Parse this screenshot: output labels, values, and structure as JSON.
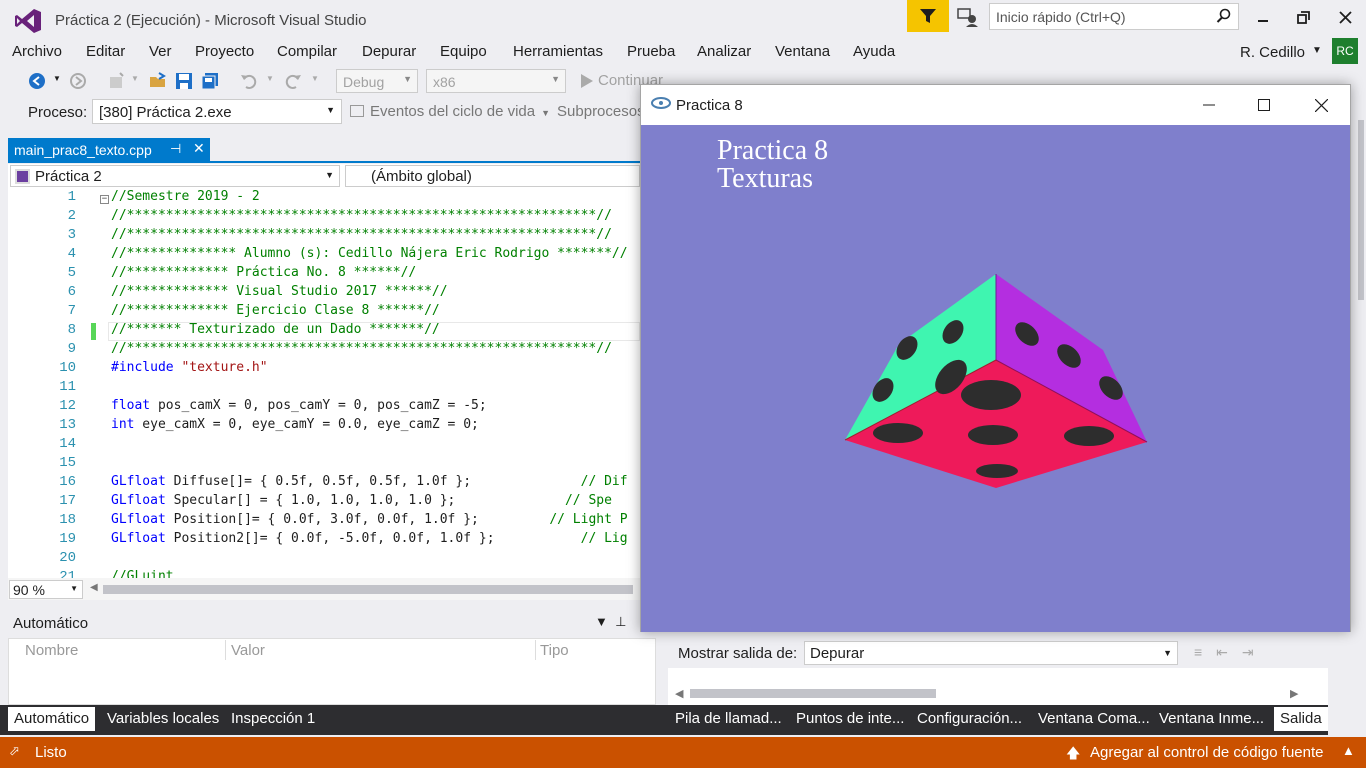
{
  "app": {
    "title": "Práctica 2 (Ejecución) - Microsoft Visual Studio",
    "quick_launch_placeholder": "Inicio rápido (Ctrl+Q)",
    "user": "R. Cedillo",
    "avatar_initials": "RC"
  },
  "menu": [
    "Archivo",
    "Editar",
    "Ver",
    "Proyecto",
    "Compilar",
    "Depurar",
    "Equipo",
    "Herramientas",
    "Prueba",
    "Analizar",
    "Ventana",
    "Ayuda"
  ],
  "toolbar": {
    "config": "Debug",
    "platform": "x86",
    "continue": "Continuar"
  },
  "process_bar": {
    "label": "Proceso:",
    "value": "[380] Práctica 2.exe",
    "events": "Eventos del ciclo de vida",
    "threads": "Subprocesos"
  },
  "editor": {
    "tab_name": "main_prac8_texto.cpp",
    "scope": "Práctica 2",
    "global_scope": "(Ámbito global)",
    "zoom": "90 %",
    "lines": [
      {
        "n": "1",
        "text": "//Semestre 2019 - 2",
        "kind": "cmt"
      },
      {
        "n": "2",
        "text": "//************************************************************//",
        "kind": "cmt"
      },
      {
        "n": "3",
        "text": "//************************************************************//",
        "kind": "cmt"
      },
      {
        "n": "4",
        "text": "//************** Alumno (s): Cedillo Nájera Eric Rodrigo *******//",
        "kind": "cmt"
      },
      {
        "n": "5",
        "text": "//************* Práctica No. 8 ******//",
        "kind": "cmt"
      },
      {
        "n": "6",
        "text": "//************* Visual Studio 2017 ******//",
        "kind": "cmt"
      },
      {
        "n": "7",
        "text": "//************* Ejercicio Clase 8 ******//",
        "kind": "cmt"
      },
      {
        "n": "8",
        "text": "//******* Texturizado de un Dado *******//",
        "kind": "cmt"
      },
      {
        "n": "9",
        "text": "//************************************************************//",
        "kind": "cmt"
      },
      {
        "n": "10",
        "text": "#include \"texture.h\"",
        "kind": "include"
      },
      {
        "n": "11",
        "text": "",
        "kind": "plain"
      },
      {
        "n": "12",
        "text": "float pos_camX = 0, pos_camY = 0, pos_camZ = -5;",
        "kind": "float"
      },
      {
        "n": "13",
        "text": "int eye_camX = 0, eye_camY = 0.0, eye_camZ = 0;",
        "kind": "int"
      },
      {
        "n": "14",
        "text": "",
        "kind": "plain"
      },
      {
        "n": "15",
        "text": "",
        "kind": "plain"
      },
      {
        "n": "16",
        "text": "GLfloat Diffuse[]= { 0.5f, 0.5f, 0.5f, 1.0f };              // Dif",
        "kind": "gl"
      },
      {
        "n": "17",
        "text": "GLfloat Specular[] = { 1.0, 1.0, 1.0, 1.0 };              // Spe",
        "kind": "gl"
      },
      {
        "n": "18",
        "text": "GLfloat Position[]= { 0.0f, 3.0f, 0.0f, 1.0f };         // Light P",
        "kind": "gl"
      },
      {
        "n": "19",
        "text": "GLfloat Position2[]= { 0.0f, -5.0f, 0.0f, 1.0f };           // Lig",
        "kind": "gl"
      },
      {
        "n": "20",
        "text": "",
        "kind": "plain"
      },
      {
        "n": "21",
        "text": "//GLuint ",
        "kind": "cmt"
      }
    ]
  },
  "autos_panel": {
    "title": "Automático",
    "columns": [
      "Nombre",
      "Valor",
      "Tipo"
    ],
    "tabs": [
      "Automático",
      "Variables locales",
      "Inspección 1"
    ]
  },
  "output_panel": {
    "label": "Mostrar salida de:",
    "value": "Depurar",
    "tabs": [
      "Pila de llamad...",
      "Puntos de inte...",
      "Configuración...",
      "Ventana Coma...",
      "Ventana Inme...",
      "Salida"
    ]
  },
  "status": {
    "text": "Listo",
    "source_control": "Agregar al control de código fuente"
  },
  "gl_window": {
    "title": "Practica 8",
    "line1": "Practica 8",
    "line2": "Texturas",
    "background": "#7f7fcc"
  },
  "colors": {
    "accent": "#007acc",
    "status": "#ca5100",
    "die_top_left": "#3ff5b0",
    "die_top_right": "#b42ee0",
    "die_front": "#ee1a5a"
  }
}
